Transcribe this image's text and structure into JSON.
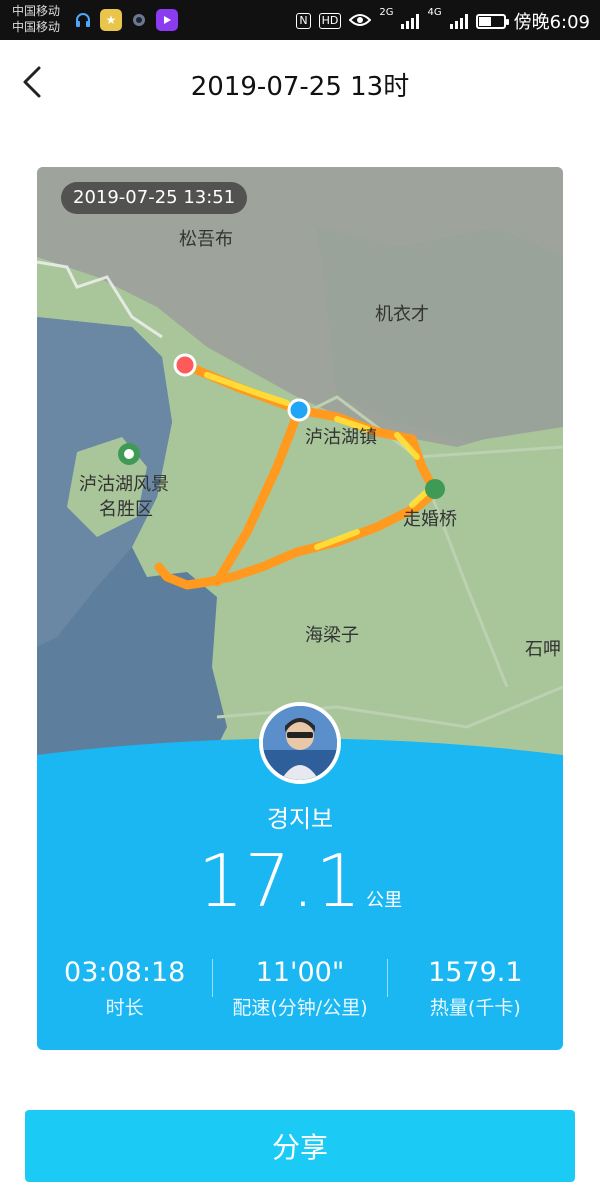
{
  "status_bar": {
    "carrier_1": "中国移动",
    "carrier_2": "中国移动",
    "nfc": "N",
    "hd": "HD",
    "net_2g": "2G",
    "net_4g": "4G",
    "time": "傍晚6:09"
  },
  "header": {
    "back_icon": "chevron-left-icon",
    "title": "2019-07-25 13时"
  },
  "map": {
    "time_badge": "2019-07-25 13:51",
    "places": {
      "songwubu": "松吾布",
      "jiyicai": "机衣才",
      "lugu_town": "泸沽湖镇",
      "lugu_scenic_1": "泸沽湖风景",
      "lugu_scenic_2": "名胜区",
      "zouhunqiao": "走婚桥",
      "hailiangzi": "海梁子",
      "shi": "石呷"
    },
    "colors": {
      "land": "#a8c79a",
      "lake": "#5d7e9c",
      "route": "#ff9a1f",
      "route_highlight": "#ffe23a",
      "start_marker": "#ff5a5a",
      "end_marker": "#21a5f5"
    }
  },
  "summary": {
    "user_name": "경지보",
    "distance_value": "17.1",
    "distance_unit": "公里",
    "stats": [
      {
        "value": "03:08:18",
        "label": "时长"
      },
      {
        "value": "11'00\"",
        "label": "配速(分钟/公里)"
      },
      {
        "value": "1579.1",
        "label": "热量(千卡)"
      }
    ]
  },
  "actions": {
    "share_label": "分享"
  },
  "theme": {
    "accent": "#1ab7f2",
    "button": "#1ccaf6"
  }
}
